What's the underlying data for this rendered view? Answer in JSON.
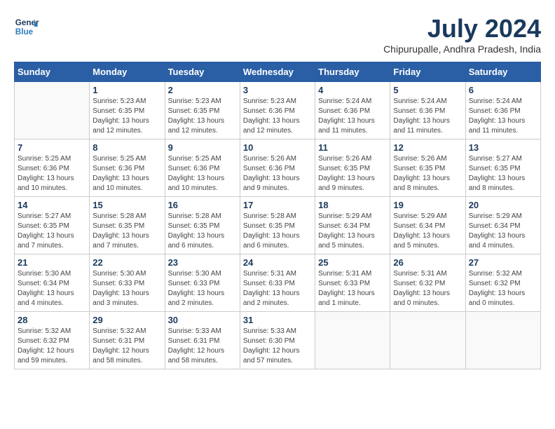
{
  "header": {
    "logo_line1": "General",
    "logo_line2": "Blue",
    "month_year": "July 2024",
    "location": "Chipurupalle, Andhra Pradesh, India"
  },
  "days_of_week": [
    "Sunday",
    "Monday",
    "Tuesday",
    "Wednesday",
    "Thursday",
    "Friday",
    "Saturday"
  ],
  "weeks": [
    [
      {
        "day": "",
        "info": ""
      },
      {
        "day": "1",
        "info": "Sunrise: 5:23 AM\nSunset: 6:35 PM\nDaylight: 13 hours\nand 12 minutes."
      },
      {
        "day": "2",
        "info": "Sunrise: 5:23 AM\nSunset: 6:35 PM\nDaylight: 13 hours\nand 12 minutes."
      },
      {
        "day": "3",
        "info": "Sunrise: 5:23 AM\nSunset: 6:36 PM\nDaylight: 13 hours\nand 12 minutes."
      },
      {
        "day": "4",
        "info": "Sunrise: 5:24 AM\nSunset: 6:36 PM\nDaylight: 13 hours\nand 11 minutes."
      },
      {
        "day": "5",
        "info": "Sunrise: 5:24 AM\nSunset: 6:36 PM\nDaylight: 13 hours\nand 11 minutes."
      },
      {
        "day": "6",
        "info": "Sunrise: 5:24 AM\nSunset: 6:36 PM\nDaylight: 13 hours\nand 11 minutes."
      }
    ],
    [
      {
        "day": "7",
        "info": "Sunrise: 5:25 AM\nSunset: 6:36 PM\nDaylight: 13 hours\nand 10 minutes."
      },
      {
        "day": "8",
        "info": "Sunrise: 5:25 AM\nSunset: 6:36 PM\nDaylight: 13 hours\nand 10 minutes."
      },
      {
        "day": "9",
        "info": "Sunrise: 5:25 AM\nSunset: 6:36 PM\nDaylight: 13 hours\nand 10 minutes."
      },
      {
        "day": "10",
        "info": "Sunrise: 5:26 AM\nSunset: 6:36 PM\nDaylight: 13 hours\nand 9 minutes."
      },
      {
        "day": "11",
        "info": "Sunrise: 5:26 AM\nSunset: 6:35 PM\nDaylight: 13 hours\nand 9 minutes."
      },
      {
        "day": "12",
        "info": "Sunrise: 5:26 AM\nSunset: 6:35 PM\nDaylight: 13 hours\nand 8 minutes."
      },
      {
        "day": "13",
        "info": "Sunrise: 5:27 AM\nSunset: 6:35 PM\nDaylight: 13 hours\nand 8 minutes."
      }
    ],
    [
      {
        "day": "14",
        "info": "Sunrise: 5:27 AM\nSunset: 6:35 PM\nDaylight: 13 hours\nand 7 minutes."
      },
      {
        "day": "15",
        "info": "Sunrise: 5:28 AM\nSunset: 6:35 PM\nDaylight: 13 hours\nand 7 minutes."
      },
      {
        "day": "16",
        "info": "Sunrise: 5:28 AM\nSunset: 6:35 PM\nDaylight: 13 hours\nand 6 minutes."
      },
      {
        "day": "17",
        "info": "Sunrise: 5:28 AM\nSunset: 6:35 PM\nDaylight: 13 hours\nand 6 minutes."
      },
      {
        "day": "18",
        "info": "Sunrise: 5:29 AM\nSunset: 6:34 PM\nDaylight: 13 hours\nand 5 minutes."
      },
      {
        "day": "19",
        "info": "Sunrise: 5:29 AM\nSunset: 6:34 PM\nDaylight: 13 hours\nand 5 minutes."
      },
      {
        "day": "20",
        "info": "Sunrise: 5:29 AM\nSunset: 6:34 PM\nDaylight: 13 hours\nand 4 minutes."
      }
    ],
    [
      {
        "day": "21",
        "info": "Sunrise: 5:30 AM\nSunset: 6:34 PM\nDaylight: 13 hours\nand 4 minutes."
      },
      {
        "day": "22",
        "info": "Sunrise: 5:30 AM\nSunset: 6:33 PM\nDaylight: 13 hours\nand 3 minutes."
      },
      {
        "day": "23",
        "info": "Sunrise: 5:30 AM\nSunset: 6:33 PM\nDaylight: 13 hours\nand 2 minutes."
      },
      {
        "day": "24",
        "info": "Sunrise: 5:31 AM\nSunset: 6:33 PM\nDaylight: 13 hours\nand 2 minutes."
      },
      {
        "day": "25",
        "info": "Sunrise: 5:31 AM\nSunset: 6:33 PM\nDaylight: 13 hours\nand 1 minute."
      },
      {
        "day": "26",
        "info": "Sunrise: 5:31 AM\nSunset: 6:32 PM\nDaylight: 13 hours\nand 0 minutes."
      },
      {
        "day": "27",
        "info": "Sunrise: 5:32 AM\nSunset: 6:32 PM\nDaylight: 13 hours\nand 0 minutes."
      }
    ],
    [
      {
        "day": "28",
        "info": "Sunrise: 5:32 AM\nSunset: 6:32 PM\nDaylight: 12 hours\nand 59 minutes."
      },
      {
        "day": "29",
        "info": "Sunrise: 5:32 AM\nSunset: 6:31 PM\nDaylight: 12 hours\nand 58 minutes."
      },
      {
        "day": "30",
        "info": "Sunrise: 5:33 AM\nSunset: 6:31 PM\nDaylight: 12 hours\nand 58 minutes."
      },
      {
        "day": "31",
        "info": "Sunrise: 5:33 AM\nSunset: 6:30 PM\nDaylight: 12 hours\nand 57 minutes."
      },
      {
        "day": "",
        "info": ""
      },
      {
        "day": "",
        "info": ""
      },
      {
        "day": "",
        "info": ""
      }
    ]
  ]
}
